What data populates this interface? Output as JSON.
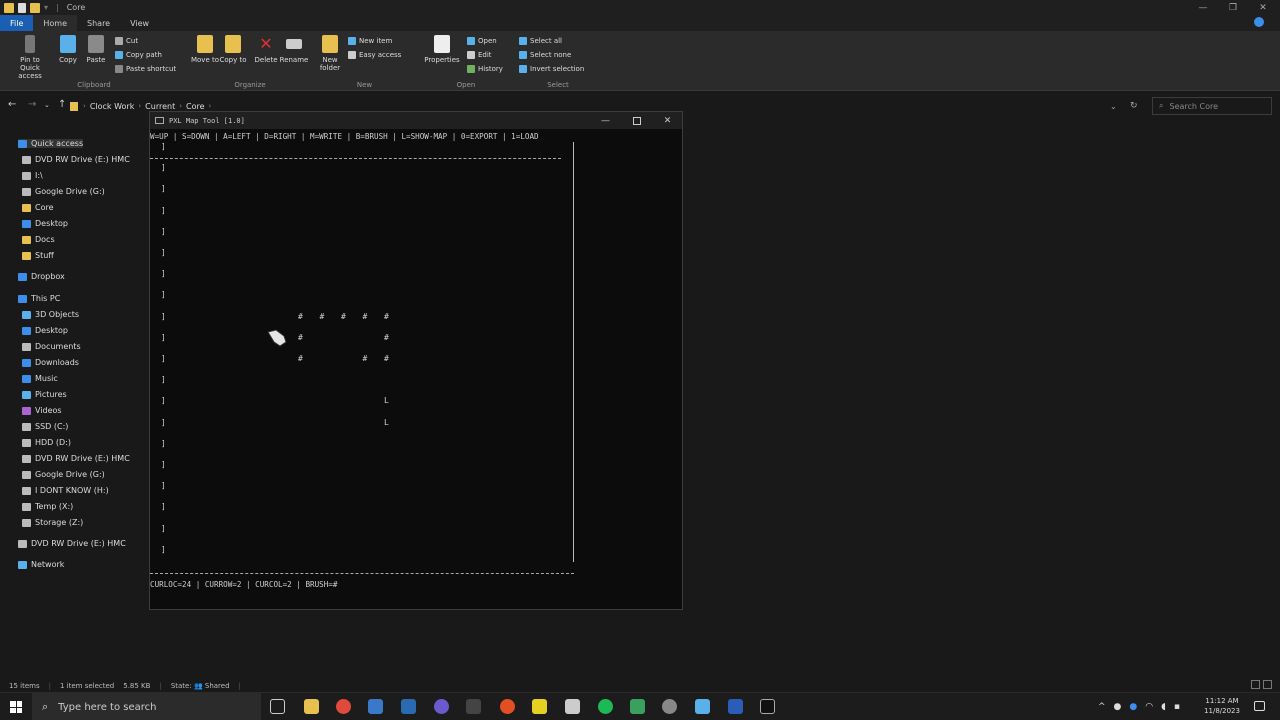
{
  "window": {
    "title": "Core",
    "controls": [
      "—",
      "❐",
      "✕"
    ]
  },
  "ribbon_tabs": [
    "File",
    "Home",
    "Share",
    "View"
  ],
  "ribbon": {
    "clipboard": {
      "label": "Clipboard",
      "pin": "Pin to Quick access",
      "copy": "Copy",
      "paste": "Paste",
      "cut": "Cut",
      "copy_path": "Copy path",
      "paste_shortcut": "Paste shortcut"
    },
    "organize": {
      "label": "Organize",
      "move_to": "Move to",
      "copy_to": "Copy to",
      "delete": "Delete",
      "rename": "Rename"
    },
    "new": {
      "label": "New",
      "new_folder": "New folder",
      "new_item": "New item",
      "easy_access": "Easy access"
    },
    "open": {
      "label": "Open",
      "properties": "Properties",
      "open": "Open",
      "edit": "Edit",
      "history": "History"
    },
    "select": {
      "label": "Select",
      "select_all": "Select all",
      "select_none": "Select none",
      "invert_selection": "Invert selection"
    }
  },
  "address": {
    "crumbs": [
      "Clock Work",
      "Current",
      "Core"
    ],
    "search_placeholder": "Search Core"
  },
  "nav": {
    "items": [
      {
        "label": "Quick access",
        "color": "#3d8ee8"
      },
      {
        "label": "DVD RW Drive (E:) HMC",
        "color": "#bbbbbb"
      },
      {
        "label": "I:\\",
        "color": "#bbbbbb"
      },
      {
        "label": "Google Drive (G:)",
        "color": "#bbbbbb"
      },
      {
        "label": "Core",
        "color": "#e8c050"
      },
      {
        "label": "Desktop",
        "color": "#3d8ee8"
      },
      {
        "label": "Docs",
        "color": "#e8c050"
      },
      {
        "label": "Stuff",
        "color": "#e8c050"
      },
      {
        "label": "Dropbox",
        "color": "#3d8ee8"
      },
      {
        "label": "This PC",
        "color": "#3d8ee8"
      },
      {
        "label": "3D Objects",
        "color": "#5ab0e8"
      },
      {
        "label": "Desktop",
        "color": "#3d8ee8"
      },
      {
        "label": "Documents",
        "color": "#bbbbbb"
      },
      {
        "label": "Downloads",
        "color": "#3d8ee8"
      },
      {
        "label": "Music",
        "color": "#3d8ee8"
      },
      {
        "label": "Pictures",
        "color": "#5ab0e8"
      },
      {
        "label": "Videos",
        "color": "#aa66cc"
      },
      {
        "label": "SSD (C:)",
        "color": "#bbbbbb"
      },
      {
        "label": "HDD (D:)",
        "color": "#bbbbbb"
      },
      {
        "label": "DVD RW Drive (E:) HMC",
        "color": "#bbbbbb"
      },
      {
        "label": "Google Drive (G:)",
        "color": "#bbbbbb"
      },
      {
        "label": "I DONT KNOW (H:)",
        "color": "#bbbbbb"
      },
      {
        "label": "Temp (X:)",
        "color": "#bbbbbb"
      },
      {
        "label": "Storage (Z:)",
        "color": "#bbbbbb"
      },
      {
        "label": "DVD RW Drive (E:) HMC",
        "color": "#bbbbbb"
      },
      {
        "label": "Network",
        "color": "#5ab0e8"
      }
    ]
  },
  "console": {
    "title": "PXL Map Tool [1.0]",
    "menu": "W=UP | S=DOWN | A=LEFT | D=RIGHT | M=WRITE | B=BRUSH | L=SHOW-MAP | 0=EXPORT | 1=LOAD",
    "status": "CURLOC=24 | CURROW=2 | CURCOL=2 | BRUSH=#",
    "map_glyphs": [
      {
        "ch": "#",
        "row": 8,
        "col": 0
      },
      {
        "ch": "#",
        "row": 8,
        "col": 1
      },
      {
        "ch": "#",
        "row": 8,
        "col": 2
      },
      {
        "ch": "#",
        "row": 8,
        "col": 3
      },
      {
        "ch": "#",
        "row": 8,
        "col": 4
      },
      {
        "ch": "#",
        "row": 9,
        "col": 0
      },
      {
        "ch": "#",
        "row": 9,
        "col": 4
      },
      {
        "ch": "#",
        "row": 10,
        "col": 0
      },
      {
        "ch": "#",
        "row": 10,
        "col": 3
      },
      {
        "ch": "#",
        "row": 10,
        "col": 4
      },
      {
        "ch": "L",
        "row": 12,
        "col": 4
      },
      {
        "ch": "L",
        "row": 13,
        "col": 4
      }
    ],
    "left_wall_char": "]"
  },
  "statusbar": {
    "items": "15 items",
    "selected": "1 item selected",
    "size": "5.85 KB",
    "state": "State: 👥 Shared"
  },
  "taskbar": {
    "search_placeholder": "Type here to search",
    "time": "11:12 AM",
    "date": "11/8/2023"
  }
}
